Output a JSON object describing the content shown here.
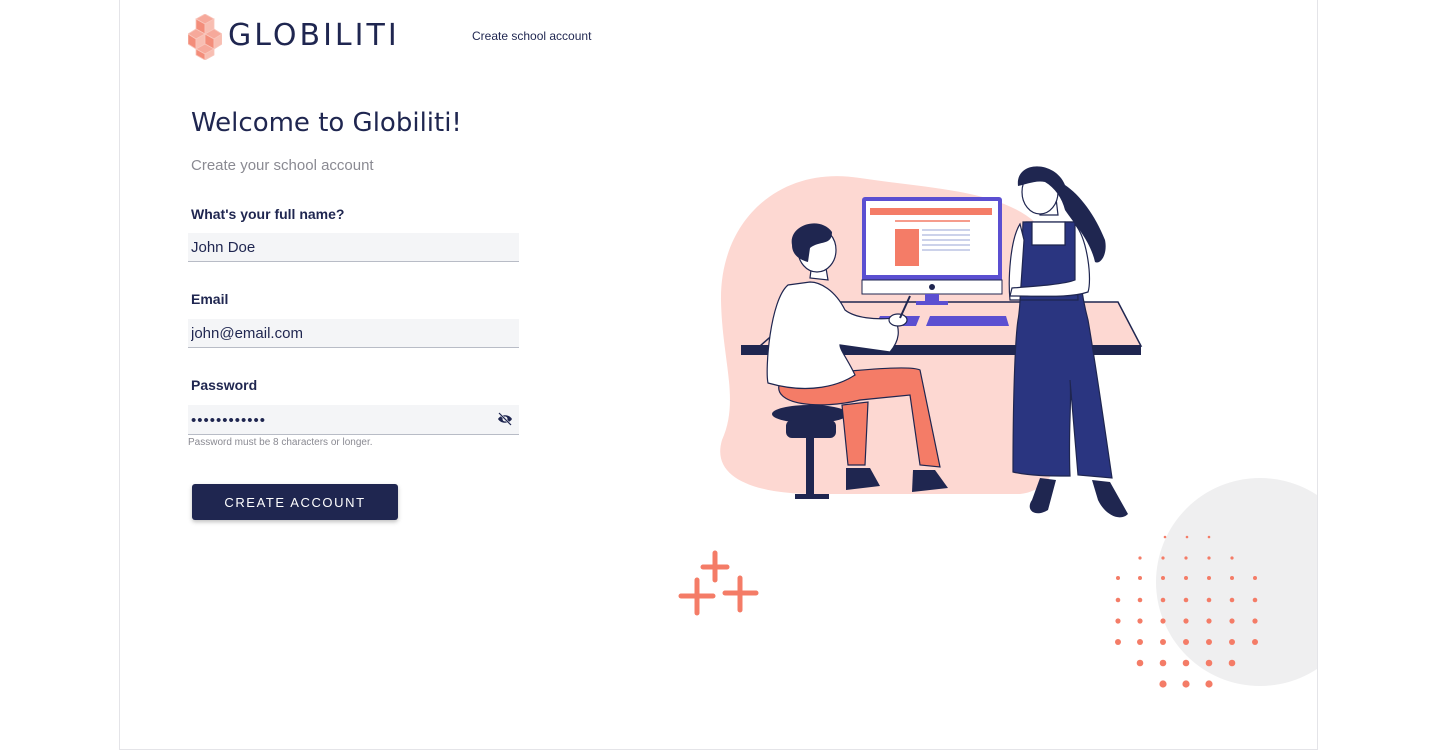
{
  "brand": {
    "name": "GLOBILITI"
  },
  "nav": {
    "create_link": "Create school account"
  },
  "form": {
    "title": "Welcome to Globiliti!",
    "subtitle": "Create your school account",
    "name_label": "What's your full name?",
    "name_value": "John Doe",
    "email_label": "Email",
    "email_value": "john@email.com",
    "password_label": "Password",
    "password_masked": "••••••••••••",
    "password_hint": "Password must be 8 characters or longer.",
    "submit_label": "CREATE ACCOUNT"
  },
  "colors": {
    "navy": "#1f2650",
    "coral": "#f47c67",
    "blush": "#fddad5",
    "purple": "#5b4fd1"
  },
  "icons": [
    "logo-cubes-icon",
    "eye-slash-icon"
  ]
}
